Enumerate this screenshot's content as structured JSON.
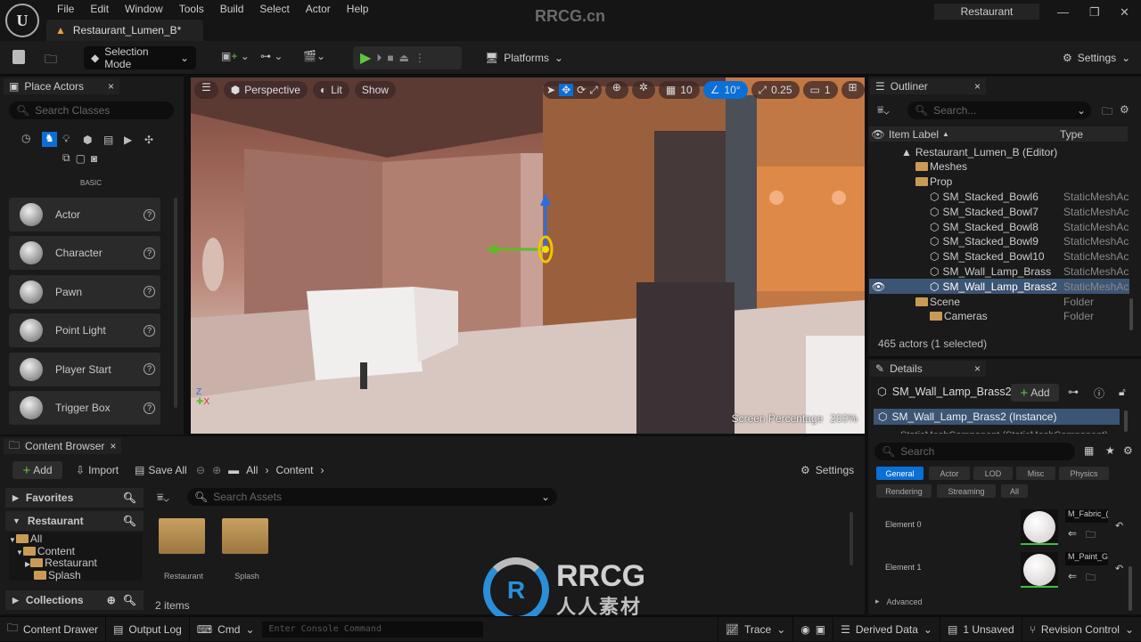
{
  "menu": {
    "items": [
      "File",
      "Edit",
      "Window",
      "Tools",
      "Build",
      "Select",
      "Actor",
      "Help"
    ],
    "doc_tab": "Restaurant_Lumen_B*",
    "watermark": "RRCG.cn",
    "project": "Restaurant"
  },
  "toolbar": {
    "selection_mode": "Selection Mode",
    "platforms": "Platforms",
    "settings": "Settings"
  },
  "place_actors": {
    "title": "Place Actors",
    "search_placeholder": "Search Classes",
    "category": "BASIC",
    "items": [
      "Actor",
      "Character",
      "Pawn",
      "Point Light",
      "Player Start",
      "Trigger Box"
    ]
  },
  "viewport": {
    "perspective": "Perspective",
    "lit": "Lit",
    "show": "Show",
    "grid": "10",
    "angle": "10°",
    "scale": "0.25",
    "camera_speed": "1",
    "screen_percentage_label": "Screen Percentage",
    "screen_percentage": "200%"
  },
  "outliner": {
    "title": "Outliner",
    "search_placeholder": "Search...",
    "col_label": "Item Label",
    "col_type": "Type",
    "rows": [
      {
        "label": "Restaurant_Lumen_B (Editor)",
        "type": "",
        "indent": 1,
        "kind": "level"
      },
      {
        "label": "Meshes",
        "type": "",
        "indent": 2,
        "kind": "folder"
      },
      {
        "label": "Prop",
        "type": "",
        "indent": 2,
        "kind": "folder"
      },
      {
        "label": "SM_Stacked_Bowl6",
        "type": "StaticMeshAc",
        "indent": 3,
        "kind": "mesh"
      },
      {
        "label": "SM_Stacked_Bowl7",
        "type": "StaticMeshAc",
        "indent": 3,
        "kind": "mesh"
      },
      {
        "label": "SM_Stacked_Bowl8",
        "type": "StaticMeshAc",
        "indent": 3,
        "kind": "mesh"
      },
      {
        "label": "SM_Stacked_Bowl9",
        "type": "StaticMeshAc",
        "indent": 3,
        "kind": "mesh"
      },
      {
        "label": "SM_Stacked_Bowl10",
        "type": "StaticMeshAc",
        "indent": 3,
        "kind": "mesh"
      },
      {
        "label": "SM_Wall_Lamp_Brass",
        "type": "StaticMeshAc",
        "indent": 3,
        "kind": "mesh"
      },
      {
        "label": "SM_Wall_Lamp_Brass2",
        "type": "StaticMeshAc",
        "indent": 3,
        "kind": "mesh",
        "selected": true
      },
      {
        "label": "Scene",
        "type": "Folder",
        "indent": 2,
        "kind": "folder"
      },
      {
        "label": "Cameras",
        "type": "Folder",
        "indent": 3,
        "kind": "folder"
      }
    ],
    "footer": "465 actors (1 selected)"
  },
  "details": {
    "title": "Details",
    "actor": "SM_Wall_Lamp_Brass2",
    "add": "Add",
    "instance": "SM_Wall_Lamp_Brass2 (Instance)",
    "component": "StaticMeshComponent (StaticMeshComponent)",
    "search_placeholder": "Search",
    "filters": [
      "General",
      "Actor",
      "LOD",
      "Misc",
      "Physics",
      "Rendering",
      "Streaming",
      "All"
    ],
    "elements": [
      {
        "label": "Element 0",
        "material": "M_Fabric_("
      },
      {
        "label": "Element 1",
        "material": "M_Paint_Gr"
      }
    ],
    "advanced": "Advanced"
  },
  "content_browser": {
    "title": "Content Browser",
    "add": "Add",
    "import": "Import",
    "save_all": "Save All",
    "breadcrumb": [
      "All",
      "Content"
    ],
    "settings": "Settings",
    "favorites": "Favorites",
    "restaurant": "Restaurant",
    "tree": [
      "All",
      "Content",
      "Restaurant",
      "Splash"
    ],
    "collections": "Collections",
    "search_placeholder": "Search Assets",
    "assets": [
      "Restaurant",
      "Splash"
    ],
    "count": "2 items"
  },
  "statusbar": {
    "content_drawer": "Content Drawer",
    "output_log": "Output Log",
    "cmd": "Cmd",
    "console_placeholder": "Enter Console Command",
    "trace": "Trace",
    "derived_data": "Derived Data",
    "unsaved": "1 Unsaved",
    "revision_control": "Revision Control"
  },
  "watermark_logo": {
    "text": "RRCG",
    "sub": "人人素材"
  },
  "colors": {
    "accent": "#0a6fd6",
    "selected_row": "#3d5574",
    "play": "#5fc93d",
    "add_plus": "#6cc24a"
  }
}
